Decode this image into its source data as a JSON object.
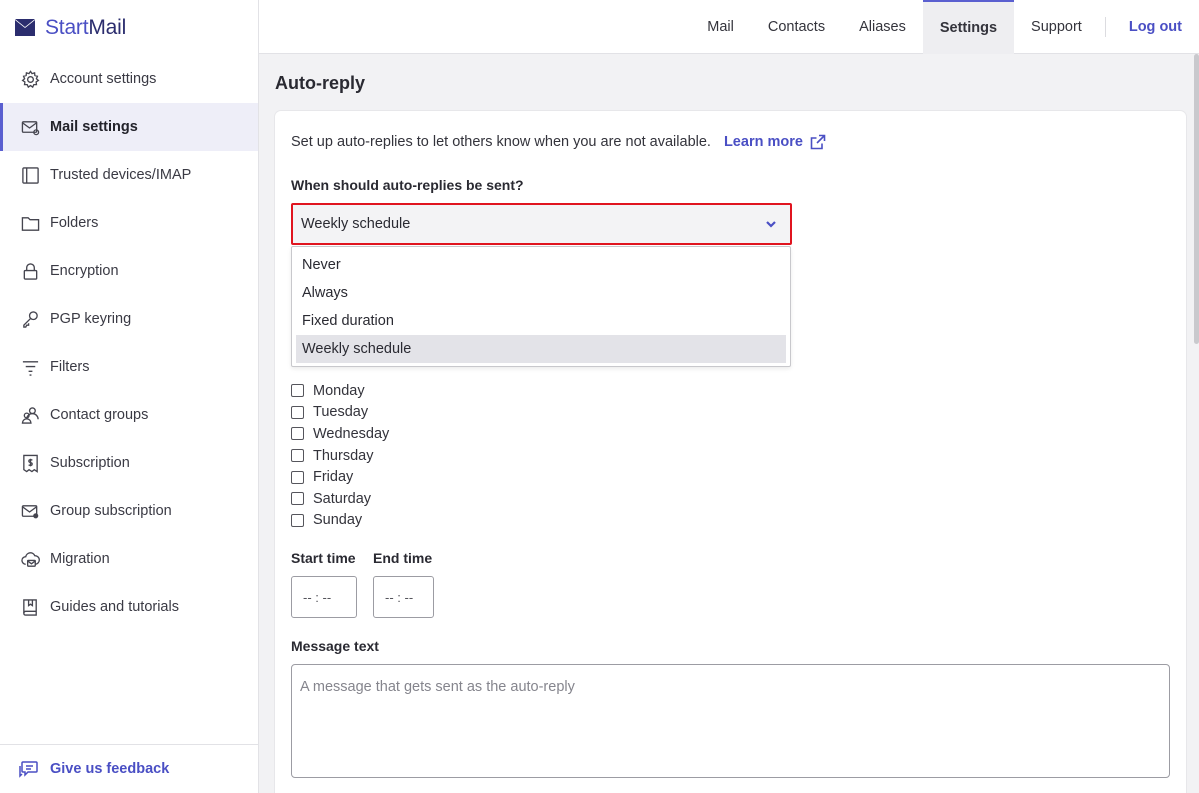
{
  "brand": {
    "name_part1": "Start",
    "name_part2": "Mail"
  },
  "sidebar": {
    "items": [
      {
        "label": "Account settings",
        "icon": "gear-icon"
      },
      {
        "label": "Mail settings",
        "icon": "mail-settings-icon",
        "active": true
      },
      {
        "label": "Trusted devices/IMAP",
        "icon": "devices-icon"
      },
      {
        "label": "Folders",
        "icon": "folder-icon"
      },
      {
        "label": "Encryption",
        "icon": "lock-icon"
      },
      {
        "label": "PGP keyring",
        "icon": "key-icon"
      },
      {
        "label": "Filters",
        "icon": "filter-icon"
      },
      {
        "label": "Contact groups",
        "icon": "contact-groups-icon"
      },
      {
        "label": "Subscription",
        "icon": "subscription-icon"
      },
      {
        "label": "Group subscription",
        "icon": "group-subscription-icon"
      },
      {
        "label": "Migration",
        "icon": "cloud-migration-icon"
      },
      {
        "label": "Guides and tutorials",
        "icon": "book-icon"
      }
    ],
    "feedback_label": "Give us feedback"
  },
  "topnav": {
    "items": [
      "Mail",
      "Contacts",
      "Aliases",
      "Settings",
      "Support"
    ],
    "active": "Settings",
    "logout": "Log out"
  },
  "main": {
    "title": "Auto-reply",
    "intro": "Set up auto-replies to let others know when you are not available.",
    "learn_more": "Learn more",
    "when_label": "When should auto-replies be sent?",
    "select_value": "Weekly schedule",
    "options": [
      "Never",
      "Always",
      "Fixed duration",
      "Weekly schedule"
    ],
    "selected_option": "Weekly schedule",
    "days": [
      "Monday",
      "Tuesday",
      "Wednesday",
      "Thursday",
      "Friday",
      "Saturday",
      "Sunday"
    ],
    "start_time_label": "Start time",
    "end_time_label": "End time",
    "start_time_value": "-- : --",
    "end_time_value": "-- : --",
    "message_label": "Message text",
    "message_placeholder": "A message that gets sent as the auto-reply"
  },
  "colors": {
    "accent": "#4a4fc4",
    "highlight": "#e0141f"
  }
}
